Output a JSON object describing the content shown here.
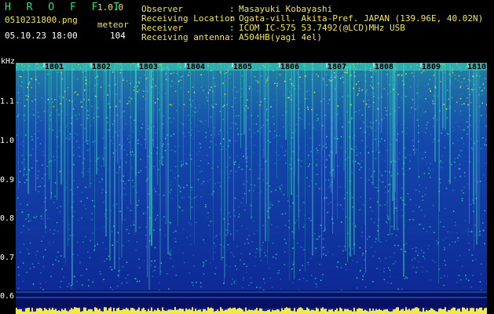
{
  "header": {
    "title": "H R O F F T",
    "version": "1.0.0",
    "filename": "0510231800.png",
    "datetime": "05.10.23 18:00",
    "mode": "meteor",
    "count": "104"
  },
  "info": [
    {
      "label": "Observer",
      "value": "Masayuki Kobayashi"
    },
    {
      "label": "Receiving Location",
      "value": "Ogata-vill. Akita-Pref. JAPAN (139.96E, 40.02N)"
    },
    {
      "label": "Receiver",
      "value": "ICOM IC-575 53.7492(@LCD)MHz USB"
    },
    {
      "label": "Receiving antenna",
      "value": "A504HB(yagi 4el)"
    }
  ],
  "spectrogram": {
    "unit": "kHz",
    "y_ticks": [
      "1.1",
      "1.0",
      "0.9",
      "0.8",
      "0.7",
      "0.6"
    ],
    "x_ticks": [
      "1801",
      "1802",
      "1803",
      "1804",
      "1805",
      "1806",
      "1807",
      "1808",
      "1809",
      "1810"
    ],
    "colors": {
      "low": "#0a1a8a",
      "mid": "#1f7fd6",
      "high": "#36d6b8",
      "peak": "#e8f23a",
      "baseline": "#f2e84a"
    }
  }
}
